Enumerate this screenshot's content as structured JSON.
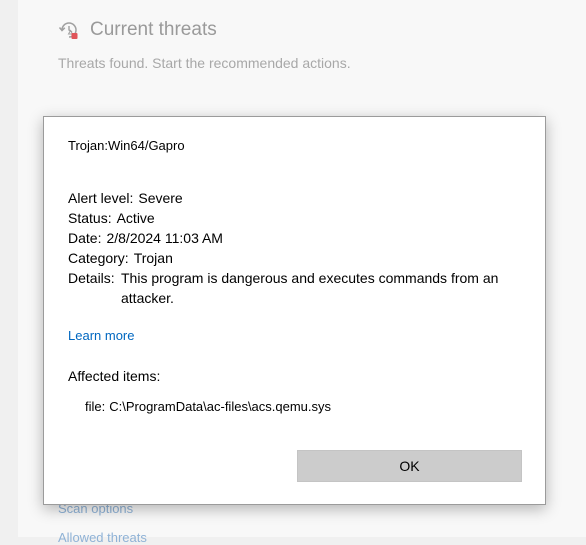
{
  "background": {
    "section_title": "Current threats",
    "section_subtitle": "Threats found. Start the recommended actions.",
    "icon": "threat-history-icon",
    "links": {
      "scan_options": "Scan options",
      "allowed_threats": "Allowed threats"
    }
  },
  "dialog": {
    "threat_name": "Trojan:Win64/Gapro",
    "properties": {
      "alert_level": {
        "label": "Alert level:",
        "value": "Severe"
      },
      "status": {
        "label": "Status:",
        "value": "Active"
      },
      "date": {
        "label": "Date:",
        "value": "2/8/2024 11:03 AM"
      },
      "category": {
        "label": "Category:",
        "value": "Trojan"
      },
      "details": {
        "label": "Details:",
        "value": "This program is dangerous and executes commands from an attacker."
      }
    },
    "learn_more": "Learn more",
    "affected_items_title": "Affected items:",
    "affected_item": {
      "type": "file:",
      "path": "C:\\ProgramData\\ac-files\\acs.qemu.sys"
    },
    "ok_label": "OK"
  },
  "colors": {
    "link": "#0067c0",
    "muted_link": "#8fb2d6",
    "threat_icon_accent": "#e0555a",
    "button": "#cccccc"
  }
}
